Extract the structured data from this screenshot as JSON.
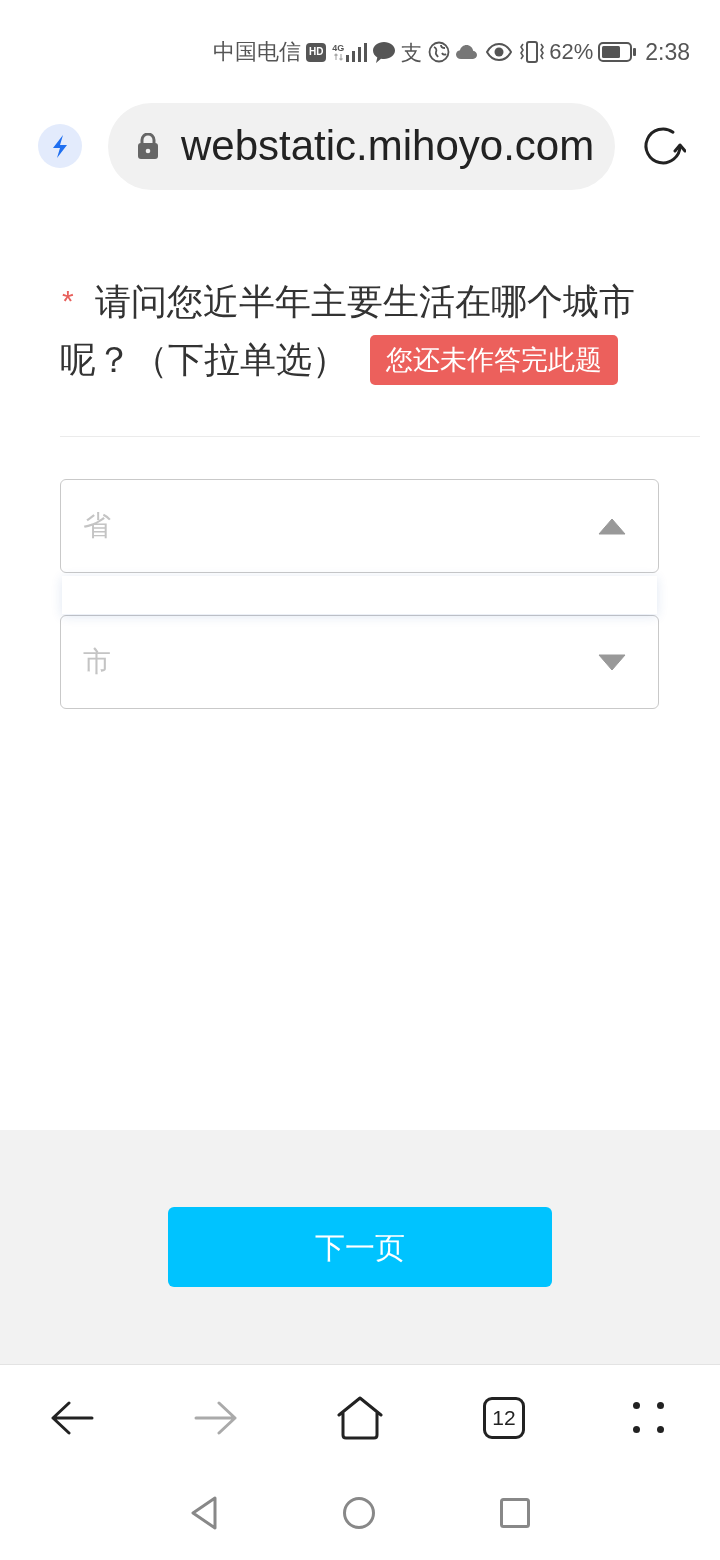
{
  "status_bar": {
    "carrier": "中国电信",
    "hd_badge": "HD",
    "network_type": "4G",
    "notification_glyph": "支",
    "battery_percent": "62%",
    "time": "2:38"
  },
  "address_bar": {
    "url": "webstatic.mihoyo.com"
  },
  "question": {
    "required_mark": "*",
    "text_lines": [
      "请问您近半年主要生活在哪个城市",
      "呢？（下拉单选）"
    ],
    "error_badge": "您还未作答完此题",
    "selects": [
      {
        "placeholder": "省",
        "expanded": true
      },
      {
        "placeholder": "市",
        "expanded": false
      }
    ]
  },
  "footer": {
    "next_button": "下一页"
  },
  "browser_toolbar": [
    {
      "kind": "back",
      "disabled": false
    },
    {
      "kind": "forward",
      "disabled": true
    },
    {
      "kind": "home",
      "disabled": false
    },
    {
      "kind": "tabs",
      "label": "12",
      "disabled": false
    },
    {
      "kind": "menu",
      "disabled": false
    }
  ]
}
